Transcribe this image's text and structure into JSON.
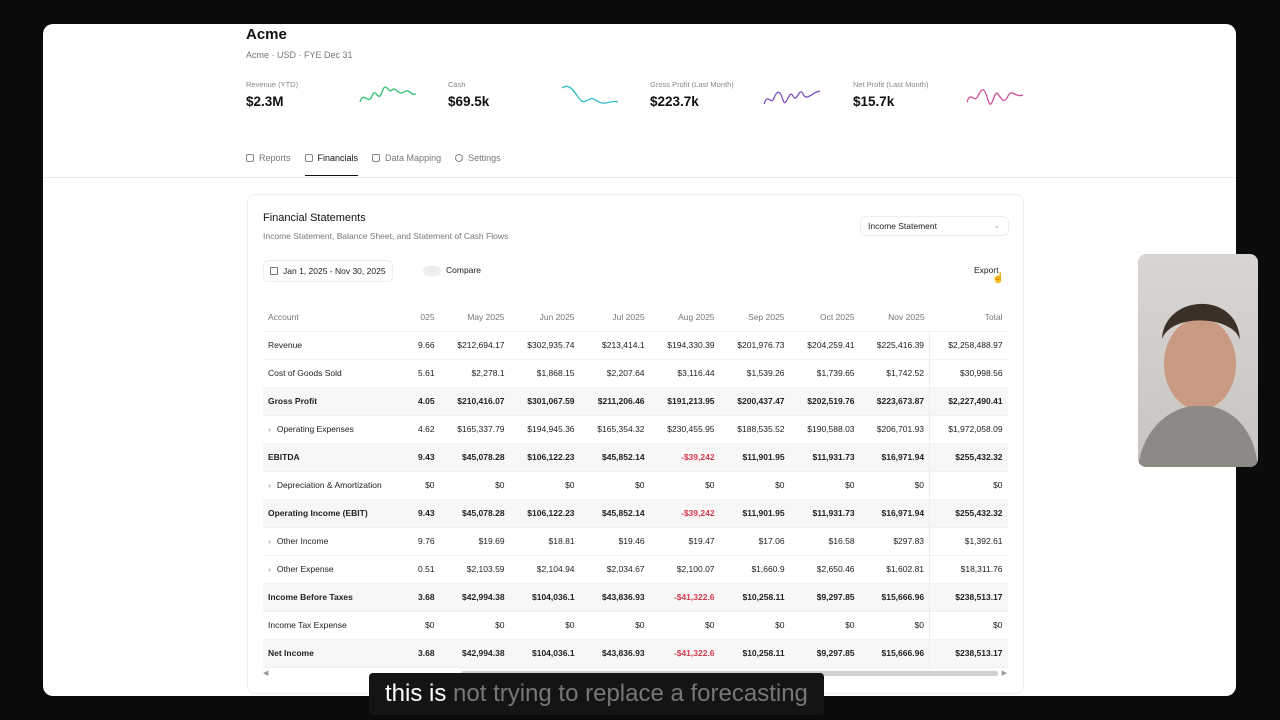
{
  "company": {
    "name": "Acme",
    "meta": "Acme · USD · FYE Dec 31"
  },
  "metrics": [
    {
      "label": "Revenue (YTD)",
      "value": "$2.3M",
      "color": "#2fbf71"
    },
    {
      "label": "Cash",
      "value": "$69.5k",
      "color": "#2fbcc4"
    },
    {
      "label": "Gross Profit (Last Month)",
      "value": "$223.7k",
      "color": "#7b4cc2"
    },
    {
      "label": "Net Profit (Last Month)",
      "value": "$15.7k",
      "color": "#d24c9a"
    }
  ],
  "tabs": [
    {
      "label": "Reports",
      "icon": "layers-icon"
    },
    {
      "label": "Financials",
      "icon": "table-icon"
    },
    {
      "label": "Data Mapping",
      "icon": "book-icon"
    },
    {
      "label": "Settings",
      "icon": "gear-icon"
    }
  ],
  "card": {
    "title": "Financial Statements",
    "subtitle": "Income Statement, Balance Sheet, and Statement of Cash Flows",
    "statement_select": "Income Statement",
    "date_range": "Jan 1, 2025 - Nov 30, 2025",
    "compare_label": "Compare",
    "export_label": "Export"
  },
  "table": {
    "headers": [
      "Account",
      "025",
      "May 2025",
      "Jun 2025",
      "Jul 2025",
      "Aug 2025",
      "Sep 2025",
      "Oct 2025",
      "Nov 2025",
      "Total"
    ],
    "rows": [
      {
        "account": "Revenue",
        "cells": [
          "9.66",
          "$212,694.17",
          "$302,935.74",
          "$213,414.1",
          "$194,330.39",
          "$201,976.73",
          "$204,259.41",
          "$225,416.39",
          "$2,258,488.97"
        ]
      },
      {
        "account": "Cost of Goods Sold",
        "cells": [
          "5.61",
          "$2,278.1",
          "$1,868.15",
          "$2,207.64",
          "$3,116.44",
          "$1,539.26",
          "$1,739.65",
          "$1,742.52",
          "$30,998.56"
        ]
      },
      {
        "account": "Gross Profit",
        "cells": [
          "4.05",
          "$210,416.07",
          "$301,067.59",
          "$211,206.46",
          "$191,213.95",
          "$200,437.47",
          "$202,519.76",
          "$223,673.87",
          "$2,227,490.41"
        ]
      },
      {
        "account": "Operating Expenses",
        "cells": [
          "4.62",
          "$165,337.79",
          "$194,945.36",
          "$165,354.32",
          "$230,455.95",
          "$188,535.52",
          "$190,588.03",
          "$206,701.93",
          "$1,972,058.09"
        ]
      },
      {
        "account": "EBITDA",
        "cells": [
          "9.43",
          "$45,078.28",
          "$106,122.23",
          "$45,852.14",
          "-$39,242",
          "$11,901.95",
          "$11,931.73",
          "$16,971.94",
          "$255,432.32"
        ]
      },
      {
        "account": "Depreciation & Amortization",
        "cells": [
          "$0",
          "$0",
          "$0",
          "$0",
          "$0",
          "$0",
          "$0",
          "$0",
          "$0"
        ]
      },
      {
        "account": "Operating Income (EBIT)",
        "cells": [
          "9.43",
          "$45,078.28",
          "$106,122.23",
          "$45,852.14",
          "-$39,242",
          "$11,901.95",
          "$11,931.73",
          "$16,971.94",
          "$255,432.32"
        ]
      },
      {
        "account": "Other Income",
        "cells": [
          "9.76",
          "$19.69",
          "$18.81",
          "$19.46",
          "$19.47",
          "$17.06",
          "$16.58",
          "$297.83",
          "$1,392.61"
        ]
      },
      {
        "account": "Other Expense",
        "cells": [
          "0.51",
          "$2,103.59",
          "$2,104.94",
          "$2,034.67",
          "$2,100.07",
          "$1,660.9",
          "$2,650.46",
          "$1,602.81",
          "$18,311.76"
        ]
      },
      {
        "account": "Income Before Taxes",
        "cells": [
          "3.68",
          "$42,994.38",
          "$104,036.1",
          "$43,836.93",
          "-$41,322.6",
          "$10,258.11",
          "$9,297.85",
          "$15,666.96",
          "$238,513.17"
        ]
      },
      {
        "account": "Income Tax Expense",
        "cells": [
          "$0",
          "$0",
          "$0",
          "$0",
          "$0",
          "$0",
          "$0",
          "$0",
          "$0"
        ]
      },
      {
        "account": "Net Income",
        "cells": [
          "3.68",
          "$42,994.38",
          "$104,036.1",
          "$43,836.93",
          "-$41,322.6",
          "$10,258.11",
          "$9,297.85",
          "$15,666.96",
          "$238,513.17"
        ]
      }
    ]
  },
  "caption": {
    "spoken": "this is",
    "upcoming": "not trying to replace a forecasting"
  }
}
